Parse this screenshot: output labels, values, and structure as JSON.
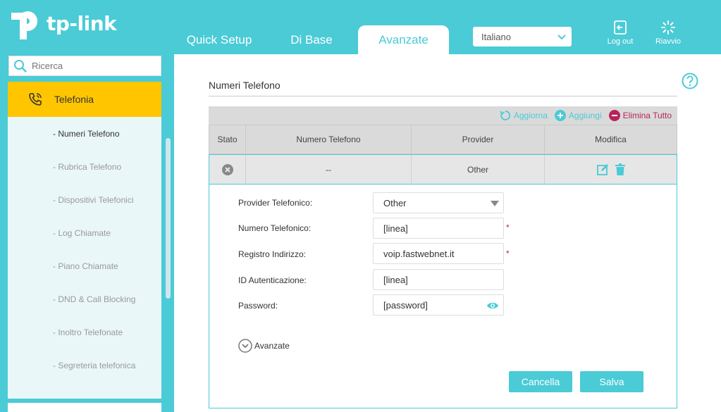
{
  "brand": {
    "name": "tp-link"
  },
  "nav": {
    "tabs": [
      "Quick Setup",
      "Di Base",
      "Avanzate"
    ],
    "active": "Avanzate"
  },
  "language": {
    "selected": "Italiano"
  },
  "header_buttons": {
    "logout": "Log out",
    "reboot": "Riavvio"
  },
  "search": {
    "placeholder": "Ricerca"
  },
  "sidebar": {
    "section": "Telefonia",
    "items": [
      "- Numeri Telefono",
      "- Rubrica Telefono",
      "- Dispositivi Telefonici",
      "- Log Chiamate",
      "- Piano Chiamate",
      "- DND & Call Blocking",
      "- Inoltro Telefonate",
      "- Segreteria telefonica"
    ]
  },
  "page": {
    "title": "Numeri Telefono"
  },
  "toolbar": {
    "refresh": "Aggiorna",
    "add": "Aggiungi",
    "delete_all": "Elimina Tutto"
  },
  "table": {
    "headers": [
      "Stato",
      "Numero Telefono",
      "Provider",
      "Modifica"
    ],
    "rows": [
      {
        "number": "--",
        "provider": "Other"
      }
    ]
  },
  "form": {
    "provider_label": "Provider Telefonico:",
    "provider_value": "Other",
    "number_label": "Numero Telefonico:",
    "number_value": "[linea]",
    "registrar_label": "Registro Indirizzo:",
    "registrar_value": "voip.fastwebnet.it",
    "auth_label": "ID Autenticazione:",
    "auth_value": "[linea]",
    "password_label": "Password:",
    "password_value": "[password]",
    "required_mark": "*",
    "advanced": "Avanzate",
    "cancel": "Cancella",
    "save": "Salva"
  },
  "colors": {
    "accent": "#4acbd6",
    "highlight": "#ffc600",
    "danger": "#b7245a"
  }
}
